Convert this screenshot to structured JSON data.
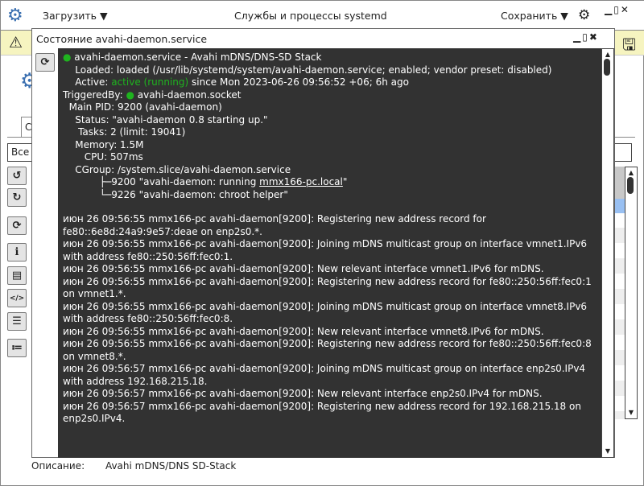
{
  "window": {
    "title": "Службы и процессы systemd",
    "load_label": "Загрузить",
    "save_label": "Сохранить"
  },
  "background": {
    "tab_label": "С",
    "filter_value": "Все",
    "description_label": "Описание:",
    "description_value": "Avahi mDNS/DNS SD-Stack"
  },
  "dialog": {
    "title": "Состояние avahi-daemon.service",
    "status": {
      "header": "avahi-daemon.service - Avahi mDNS/DNS-SD Stack",
      "loaded": "    Loaded: loaded (/usr/lib/systemd/system/avahi-daemon.service; enabled; vendor preset: disabled)",
      "active_prefix": "    Active: ",
      "active_state": "active (running)",
      "active_suffix": " since Mon 2023-06-26 09:56:52 +06; 6h ago",
      "triggered_prefix": "TriggeredBy: ",
      "triggered_unit": "avahi-daemon.socket",
      "main_pid": "  Main PID: 9200 (avahi-daemon)",
      "status_line": "    Status: \"avahi-daemon 0.8 starting up.\"",
      "tasks": "     Tasks: 2 (limit: 19041)",
      "memory": "    Memory: 1.5M",
      "cpu": "       CPU: 507ms",
      "cgroup": "    CGroup: /system.slice/avahi-daemon.service",
      "proc1_prefix": "            ├─9200 \"avahi-daemon: running ",
      "proc1_host": "mmx166-pc.local",
      "proc1_suffix": "\"",
      "proc2": "            └─9226 \"avahi-daemon: chroot helper\""
    },
    "log": [
      "июн 26 09:56:55 mmx166-pc avahi-daemon[9200]: Registering new address record for fe80::6e8d:24a9:9e57:deae on enp2s0.*.",
      "июн 26 09:56:55 mmx166-pc avahi-daemon[9200]: Joining mDNS multicast group on interface vmnet1.IPv6 with address fe80::250:56ff:fec0:1.",
      "июн 26 09:56:55 mmx166-pc avahi-daemon[9200]: New relevant interface vmnet1.IPv6 for mDNS.",
      "июн 26 09:56:55 mmx166-pc avahi-daemon[9200]: Registering new address record for fe80::250:56ff:fec0:1 on vmnet1.*.",
      "июн 26 09:56:55 mmx166-pc avahi-daemon[9200]: Joining mDNS multicast group on interface vmnet8.IPv6 with address fe80::250:56ff:fec0:8.",
      "июн 26 09:56:55 mmx166-pc avahi-daemon[9200]: New relevant interface vmnet8.IPv6 for mDNS.",
      "июн 26 09:56:55 mmx166-pc avahi-daemon[9200]: Registering new address record for fe80::250:56ff:fec0:8 on vmnet8.*.",
      "июн 26 09:56:57 mmx166-pc avahi-daemon[9200]: Joining mDNS multicast group on interface enp2s0.IPv4 with address 192.168.215.18.",
      "июн 26 09:56:57 mmx166-pc avahi-daemon[9200]: New relevant interface enp2s0.IPv4 for mDNS.",
      "июн 26 09:56:57 mmx166-pc avahi-daemon[9200]: Registering new address record for 192.168.215.18 on enp2s0.IPv4."
    ]
  },
  "colors": {
    "accent": "#3a6fb0",
    "active": "#1fb31f",
    "terminal_bg": "#323232",
    "warning_bar": "#f6f4c0",
    "selected_row": "#99c0f2"
  }
}
